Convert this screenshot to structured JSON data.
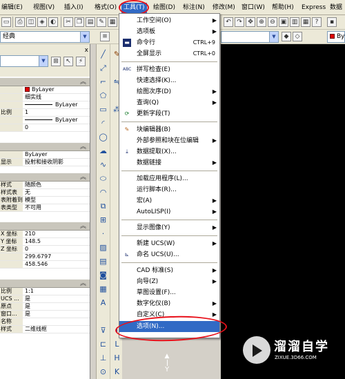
{
  "menubar": {
    "items": [
      {
        "label": "编辑(E)"
      },
      {
        "label": "视图(V)"
      },
      {
        "label": "插入(I)"
      },
      {
        "label": "格式(O)"
      },
      {
        "label": "工具(T)"
      },
      {
        "label": "绘图(D)"
      },
      {
        "label": "标注(N)"
      },
      {
        "label": "修改(M)"
      },
      {
        "label": "窗口(W)"
      },
      {
        "label": "帮助(H)"
      },
      {
        "label": "Express"
      },
      {
        "label": "数据"
      }
    ]
  },
  "toolbar": {
    "workspace_value": "经典",
    "layer_value": "",
    "bylayer_value": "ByL"
  },
  "palette": {
    "close_glyph": "x",
    "sections": {
      "general": {
        "rows": [
          {
            "name": "",
            "value": "ByLayer"
          },
          {
            "name": "",
            "value": "细实线"
          },
          {
            "name": "",
            "value": "ByLayer"
          },
          {
            "name": "比例",
            "value": "1"
          },
          {
            "name": "",
            "value": "ByLayer"
          },
          {
            "name": "",
            "value": "0"
          }
        ]
      },
      "plot": {
        "rows": [
          {
            "name": "",
            "value": "ByLayer"
          },
          {
            "name": "显示",
            "value": "投射和接收阴影"
          }
        ]
      },
      "plotstyle": {
        "rows": [
          {
            "name": "样式",
            "value": "随颜色"
          },
          {
            "name": "样式表",
            "value": "无"
          },
          {
            "name": "表附着到",
            "value": "模型"
          },
          {
            "name": "表类型",
            "value": "不可用"
          }
        ]
      },
      "view": {
        "rows": [
          {
            "name": "X 坐标",
            "value": "210"
          },
          {
            "name": "Y 坐标",
            "value": "148.5"
          },
          {
            "name": "Z 坐标",
            "value": "0"
          },
          {
            "name": "",
            "value": "299.6797"
          },
          {
            "name": "",
            "value": "458.546"
          }
        ]
      },
      "misc": {
        "rows": [
          {
            "name": "比例",
            "value": "1:1"
          },
          {
            "name": "UCS ...",
            "value": "是"
          },
          {
            "name": "原点",
            "value": "是"
          },
          {
            "name": "窗口...",
            "value": "是"
          },
          {
            "name": "名称",
            "value": ""
          },
          {
            "name": "样式",
            "value": "二维线框"
          }
        ]
      }
    }
  },
  "tools_menu": {
    "items": [
      {
        "label": "工作空间(O)",
        "shortcut": "",
        "submenu": true,
        "icon": ""
      },
      {
        "label": "选项板",
        "shortcut": "",
        "submenu": true,
        "icon": ""
      },
      {
        "label": "命令行",
        "shortcut": "CTRL+9",
        "submenu": false,
        "icon": "command-line-icon"
      },
      {
        "label": "全屏显示",
        "shortcut": "CTRL+0",
        "submenu": false,
        "icon": ""
      },
      {
        "label": "拼写检查(E)",
        "shortcut": "",
        "submenu": false,
        "icon": "spell-check-icon"
      },
      {
        "label": "快速选择(K)...",
        "shortcut": "",
        "submenu": false,
        "icon": ""
      },
      {
        "label": "绘图次序(D)",
        "shortcut": "",
        "submenu": true,
        "icon": ""
      },
      {
        "label": "查询(Q)",
        "shortcut": "",
        "submenu": true,
        "icon": ""
      },
      {
        "label": "更新字段(T)",
        "shortcut": "",
        "submenu": false,
        "icon": "update-field-icon"
      },
      {
        "label": "块编辑器(B)",
        "shortcut": "",
        "submenu": false,
        "icon": "block-editor-icon"
      },
      {
        "label": "外部参照和块在位编辑",
        "shortcut": "",
        "submenu": true,
        "icon": ""
      },
      {
        "label": "数据提取(X)...",
        "shortcut": "",
        "submenu": false,
        "icon": "data-extraction-icon"
      },
      {
        "label": "数据链接",
        "shortcut": "",
        "submenu": true,
        "icon": ""
      },
      {
        "label": "加载应用程序(L)...",
        "shortcut": "",
        "submenu": false,
        "icon": ""
      },
      {
        "label": "运行脚本(R)...",
        "shortcut": "",
        "submenu": false,
        "icon": ""
      },
      {
        "label": "宏(A)",
        "shortcut": "",
        "submenu": true,
        "icon": ""
      },
      {
        "label": "AutoLISP(I)",
        "shortcut": "",
        "submenu": true,
        "icon": ""
      },
      {
        "label": "显示图像(Y)",
        "shortcut": "",
        "submenu": true,
        "icon": ""
      },
      {
        "label": "新建 UCS(W)",
        "shortcut": "",
        "submenu": true,
        "icon": ""
      },
      {
        "label": "命名 UCS(U)...",
        "shortcut": "",
        "submenu": false,
        "icon": "named-ucs-icon"
      },
      {
        "label": "CAD 标准(S)",
        "shortcut": "",
        "submenu": true,
        "icon": ""
      },
      {
        "label": "向导(Z)",
        "shortcut": "",
        "submenu": true,
        "icon": ""
      },
      {
        "label": "草图设置(F)...",
        "shortcut": "",
        "submenu": false,
        "icon": ""
      },
      {
        "label": "数字化仪(B)",
        "shortcut": "",
        "submenu": true,
        "icon": ""
      },
      {
        "label": "自定义(C)",
        "shortcut": "",
        "submenu": true,
        "icon": ""
      },
      {
        "label": "选项(N)...",
        "shortcut": "",
        "submenu": false,
        "icon": ""
      }
    ]
  },
  "drawing": {
    "ucs_y_label": "Y"
  },
  "watermark": {
    "title": "溜溜自学",
    "subtitle": "ZIXUE.3D66.COM"
  },
  "colors": {
    "menu_highlight": "#316ac5",
    "annotation_red": "#e8101a",
    "bylayer_red": "#e00000"
  }
}
